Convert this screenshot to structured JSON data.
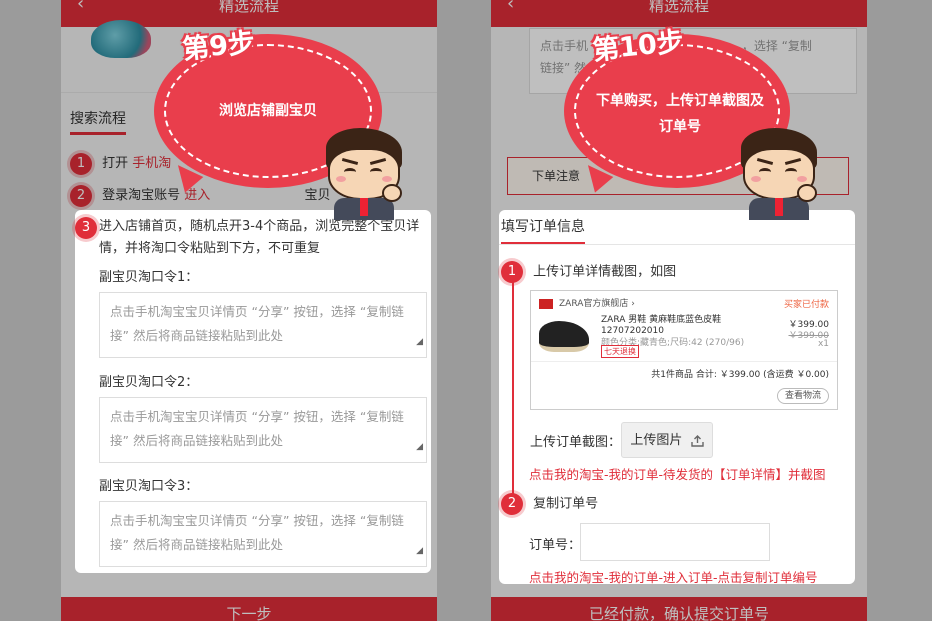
{
  "left_phone": {
    "header_title": "精选流程",
    "back_icon": "chevron-left-icon",
    "section_tab": "搜索流程",
    "bg_step1_prefix": "打开",
    "bg_step1_link": "手机淘",
    "bg_step2_prefix": "登录淘宝账号",
    "bg_step2_rest": "进入",
    "bg_step2_end": "宝贝",
    "bottom_button": "下一步"
  },
  "callout_left": {
    "step_title": "第9步",
    "text": "浏览店铺副宝贝"
  },
  "card_left": {
    "step_number": "3",
    "step_text": "进入店铺首页，随机点开3-4个商品，浏览完整个宝贝详情，并将淘口令粘贴到下方，不可重复",
    "fields": [
      {
        "label": "副宝贝淘口令1：",
        "placeholder": "点击手机淘宝宝贝详情页 “分享” 按钮，选择 “复制链接” 然后将商品链接粘贴到此处"
      },
      {
        "label": "副宝贝淘口令2：",
        "placeholder": "点击手机淘宝宝贝详情页 “分享” 按钮，选择 “复制链接” 然后将商品链接粘贴到此处"
      },
      {
        "label": "副宝贝淘口令3：",
        "placeholder": "点击手机淘宝宝贝详情页 “分享” 按钮，选择 “复制链接” 然后将商品链接粘贴到此处"
      }
    ]
  },
  "right_phone": {
    "header_title": "精选流程",
    "back_icon": "chevron-left-icon",
    "bg_textarea": "点击手机",
    "bg_textarea_tail": "，选择 “复制",
    "bg_textarea_line2": "链接” 然",
    "bg_button": "下单注意",
    "bottom_button": "已经付款，确认提交订单号"
  },
  "callout_right": {
    "step_title": "第10步",
    "text": "下单购买，上传订单截图及订单号"
  },
  "card_right": {
    "tab_title": "填写订单信息",
    "step1_number": "1",
    "step1_text": "上传订单详情截图，如图",
    "screenshot": {
      "shop_name": "ZARA官方旗舰店",
      "status": "买家已付款",
      "product_name": "ZARA 男鞋 黄麻鞋底蓝色皮鞋 12707202010",
      "price": "￥399.00",
      "orig_price": "￥399.00",
      "qty": "x1",
      "attrs": "颜色分类:藏青色;尺码:42 (270/96)",
      "tag": "七天退换",
      "total": "共1件商品 合计: ￥399.00 (含运费 ￥0.00)",
      "logistics_btn": "查看物流"
    },
    "upload_label": "上传订单截图：",
    "upload_button": "上传图片",
    "upload_icon": "upload-icon",
    "note1": "点击我的淘宝-我的订单-待发货的【订单详情】并截图",
    "step2_number": "2",
    "step2_text": "复制订单号",
    "order_label": "订单号：",
    "order_value": "",
    "note2": "点击我的淘宝-我的订单-进入订单-点击复制订单编号"
  }
}
